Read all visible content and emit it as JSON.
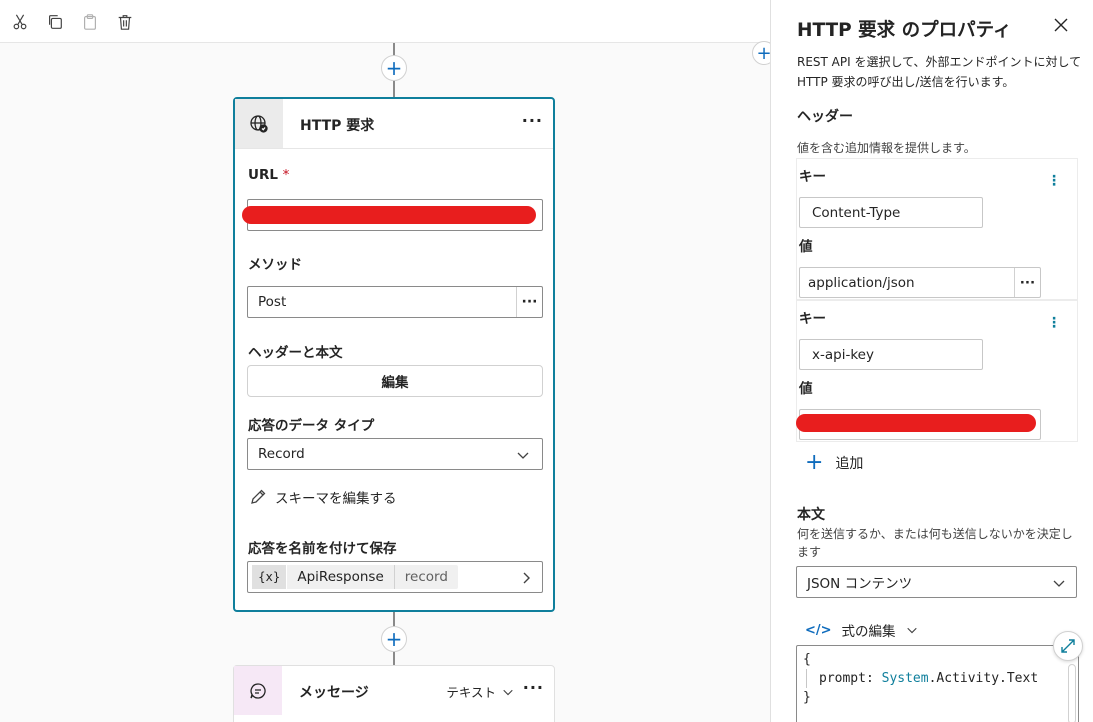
{
  "toolbar": {
    "cut_icon": "scissors-icon",
    "copy_icon": "copy-icon",
    "paste_icon": "clipboard-icon",
    "delete_icon": "trash-icon"
  },
  "http_node": {
    "title": "HTTP 要求",
    "more": "···",
    "url_label": "URL",
    "url_required": "*",
    "method_label": "メソッド",
    "method_value": "Post",
    "method_more": "···",
    "headers_body_label": "ヘッダーと本文",
    "edit_button": "編集",
    "response_type_label": "応答のデータ タイプ",
    "response_type_value": "Record",
    "edit_schema_link": "スキーマを編集する",
    "save_response_label": "応答を名前を付けて保存",
    "var_symbol": "{x}",
    "var_name": "ApiResponse",
    "var_type": "record"
  },
  "message_node": {
    "title": "メッセージ",
    "type_value": "テキスト",
    "more": "···"
  },
  "panel": {
    "title": "HTTP 要求 のプロパティ",
    "description": "REST API を選択して、外部エンドポイントに対して HTTP 要求の呼び出し/送信を行います。",
    "headers_heading": "ヘッダー",
    "headers_desc": "値を含む追加情報を提供します。",
    "header_items": [
      {
        "key_label": "キー",
        "key": "Content-Type",
        "value_label": "値",
        "value": "application/json",
        "more": "···"
      },
      {
        "key_label": "キー",
        "key": "x-api-key",
        "value_label": "値",
        "value": ""
      }
    ],
    "add_label": "追加",
    "body_heading": "本文",
    "body_desc": "何を送信するか、または何も送信しないかを決定します",
    "body_select": "JSON コンテンツ",
    "expr_label": "式の編集",
    "code_open": "{",
    "code_key": "prompt:",
    "code_obj": "System",
    "code_rest": ".Activity.Text",
    "code_close": "}"
  },
  "colors": {
    "accent": "#0f7f9c",
    "link_blue": "#0f6cbd",
    "redaction": "#e81e1e",
    "required": "#c50f1f"
  }
}
